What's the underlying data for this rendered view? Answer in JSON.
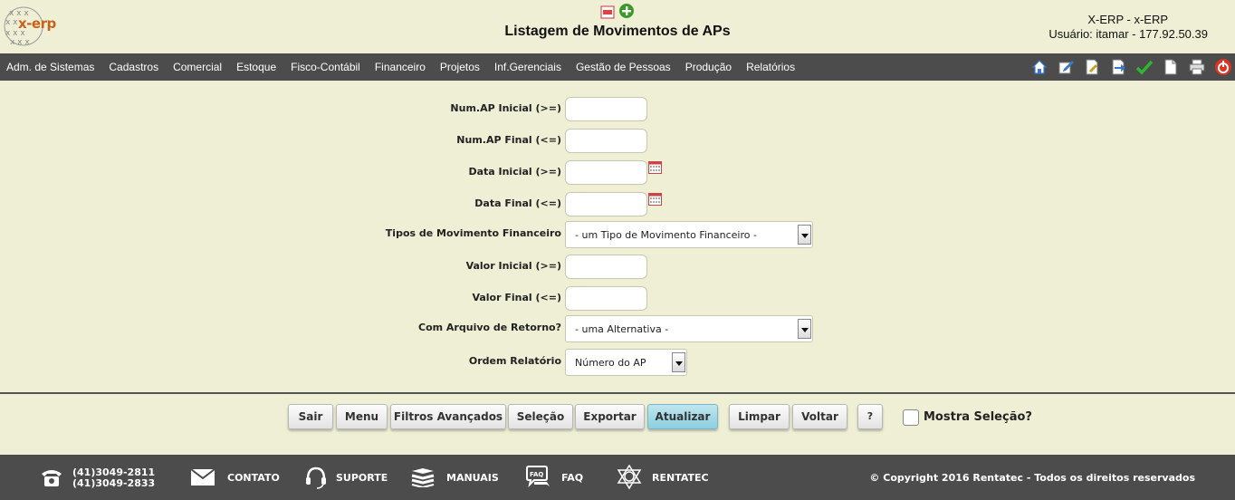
{
  "header": {
    "logo_text": "x-erp",
    "title": "Listagem de Movimentos de APs",
    "system_name": "X-ERP - x-ERP",
    "user_line": "Usuário: itamar - 177.92.50.39"
  },
  "nav": {
    "items": [
      "Adm. de Sistemas",
      "Cadastros",
      "Comercial",
      "Estoque",
      "Fisco-Contábil",
      "Financeiro",
      "Projetos",
      "Inf.Gerenciais",
      "Gestão de Pessoas",
      "Produção",
      "Relatórios"
    ],
    "tool_icons": [
      "home-icon",
      "edit-doc-icon",
      "document-edit-icon",
      "export-doc-icon",
      "checkmark-icon",
      "new-document-icon",
      "printer-icon",
      "power-icon"
    ]
  },
  "form": {
    "num_ap_inicial_label": "Num.AP Inicial (>=)",
    "num_ap_inicial_value": "",
    "num_ap_final_label": "Num.AP Final (<=)",
    "num_ap_final_value": "",
    "data_inicial_label": "Data Inicial (>=)",
    "data_inicial_value": "",
    "data_final_label": "Data Final (<=)",
    "data_final_value": "",
    "tipos_label": "Tipos de Movimento Financeiro",
    "tipos_selected": "- um Tipo de Movimento Financeiro -",
    "valor_inicial_label": "Valor Inicial (>=)",
    "valor_inicial_value": "",
    "valor_final_label": "Valor Final (<=)",
    "valor_final_value": "",
    "arquivo_label": "Com Arquivo de Retorno?",
    "arquivo_selected": "- uma Alternativa -",
    "ordem_label": "Ordem Relatório",
    "ordem_selected": "Número do AP"
  },
  "buttons": {
    "sair": "Sair",
    "menu": "Menu",
    "filtros": "Filtros Avançados",
    "selecao": "Seleção",
    "exportar": "Exportar",
    "atualizar": "Atualizar",
    "limpar": "Limpar",
    "voltar": "Voltar",
    "help": "?",
    "mostra_selecao": "Mostra Seleção?"
  },
  "footer": {
    "phone1": "(41)3049-2811",
    "phone2": "(41)3049-2833",
    "contato": "CONTATO",
    "suporte": "SUPORTE",
    "manuais": "MANUAIS",
    "faq": "FAQ",
    "rentatec": "RENTATEC",
    "copyright": "© Copyright 2016 Rentatec - Todos os direitos reservados"
  },
  "colors": {
    "background": "#efefd6",
    "bars": "#4c4c4c",
    "primary_button": "#8ccfe0",
    "logo_orange": "#c8621a"
  }
}
